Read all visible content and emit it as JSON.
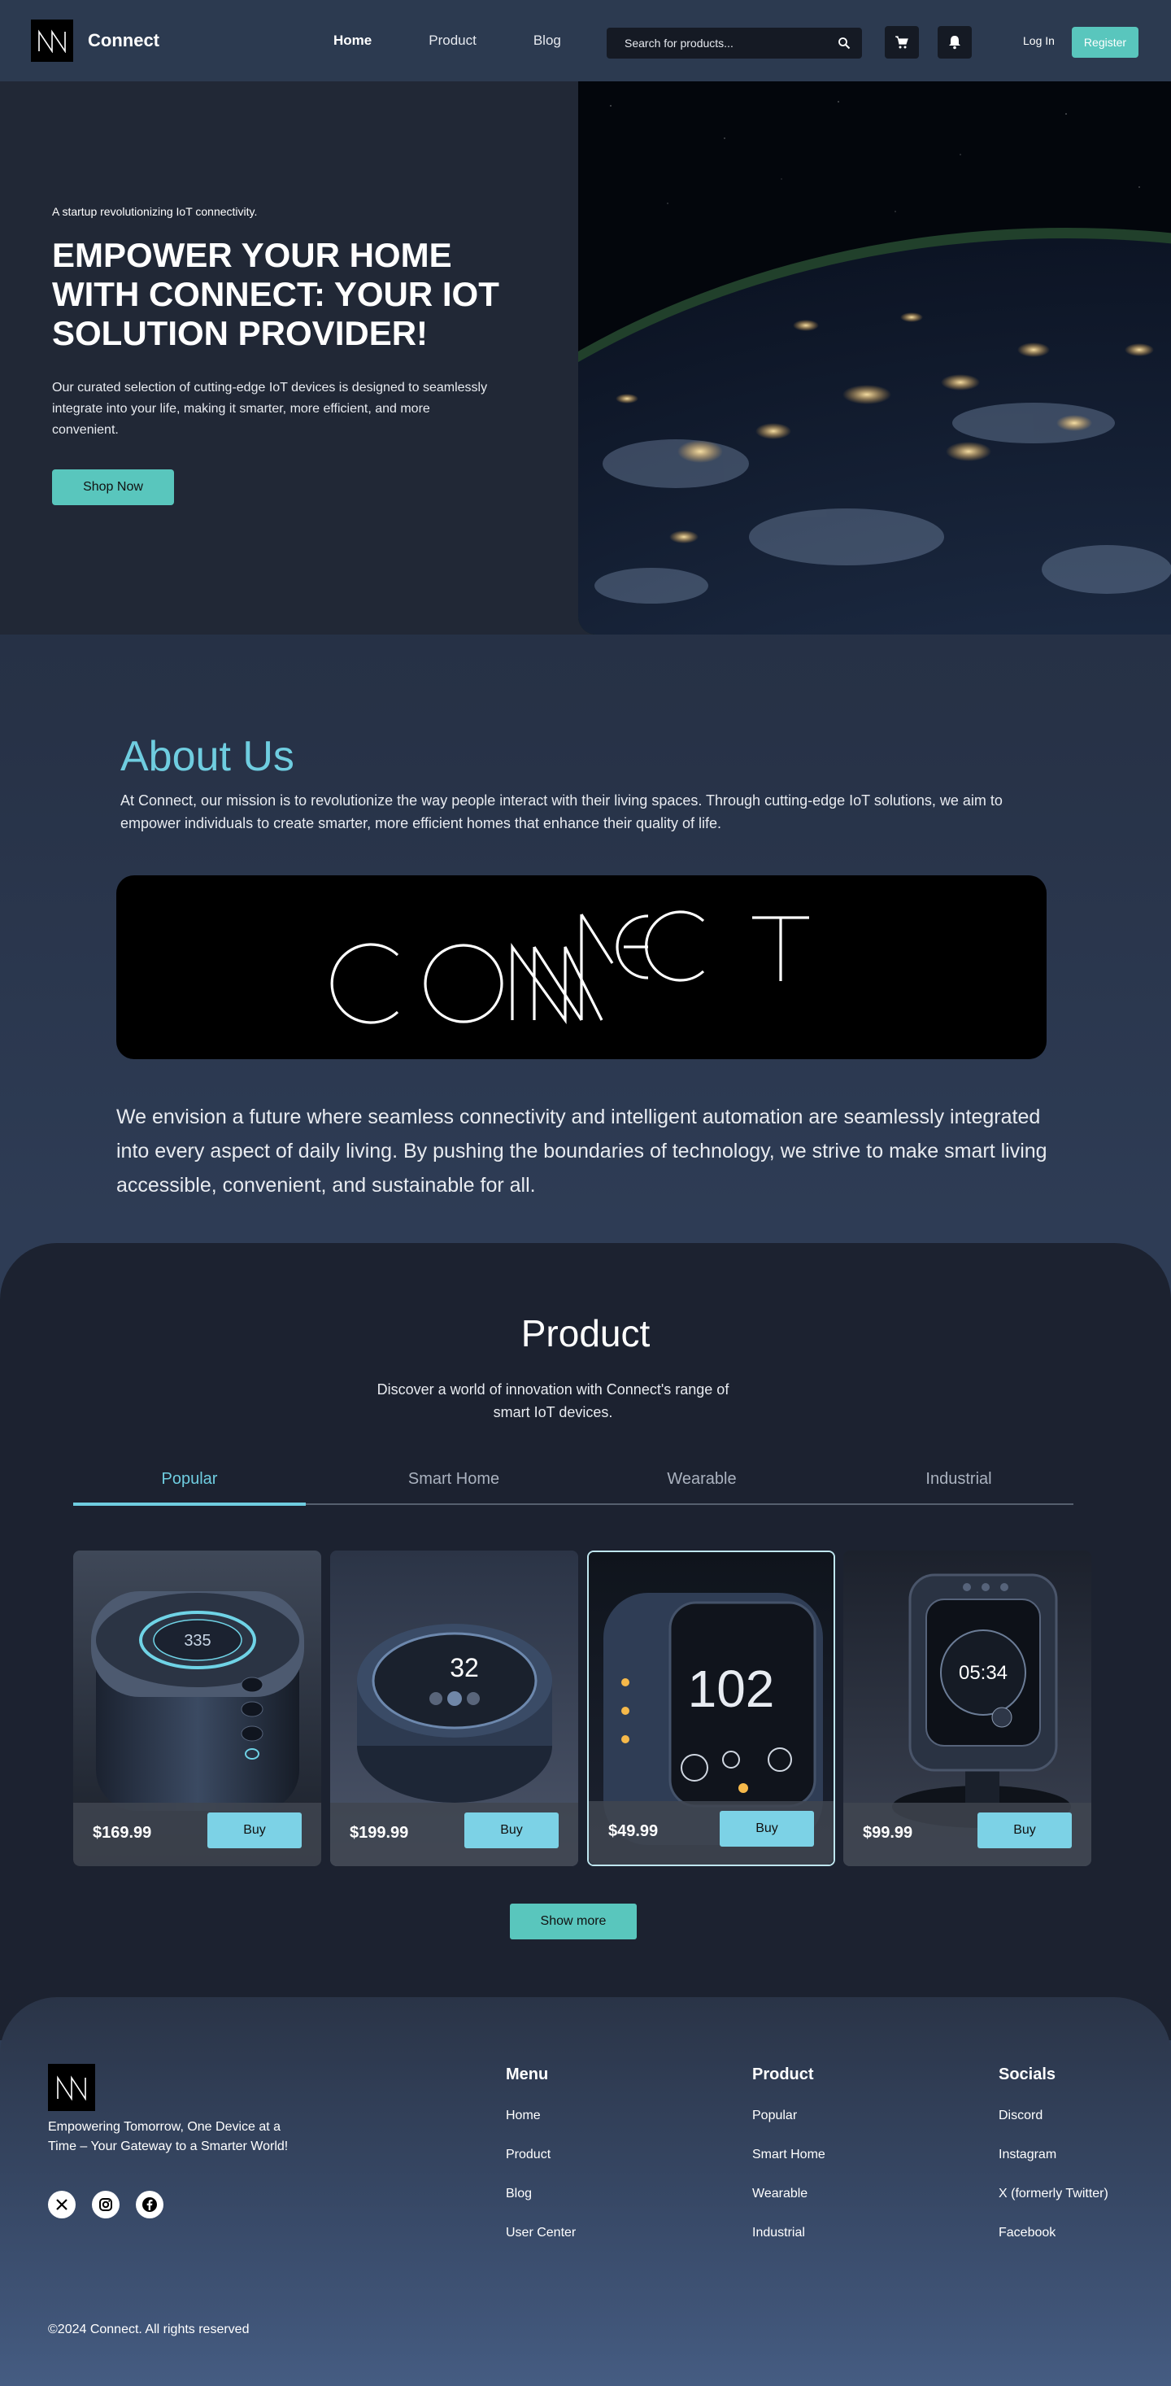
{
  "nav": {
    "brand": "Connect",
    "links": [
      "Home",
      "Product",
      "Blog"
    ],
    "search_placeholder": "Search for products...",
    "login": "Log In",
    "register": "Register"
  },
  "hero": {
    "tagline": "A startup revolutionizing IoT connectivity.",
    "title": "EMPOWER YOUR HOME WITH CONNECT: YOUR IOT SOLUTION PROVIDER!",
    "description": "Our curated selection of cutting-edge IoT devices is designed to seamlessly integrate into your life, making it smarter, more efficient, and more convenient.",
    "cta": "Shop Now"
  },
  "about": {
    "title": "About Us",
    "text": "At Connect, our mission is to revolutionize the way people interact with their living spaces. Through cutting-edge IoT solutions, we aim to empower individuals to create smarter, more efficient homes that enhance their quality of life.",
    "vision": "We envision a future where seamless connectivity and intelligent automation are seamlessly integrated into every aspect of daily living. By pushing the boundaries of technology, we strive to make smart living accessible, convenient, and sustainable for all."
  },
  "product": {
    "title": "Product",
    "subtitle": "Discover a world of innovation with Connect's range of smart IoT devices.",
    "tabs": [
      "Popular",
      "Smart Home",
      "Wearable",
      "Industrial"
    ],
    "active_tab": "Popular",
    "cards": [
      {
        "price": "$169.99",
        "buy": "Buy",
        "display": "335"
      },
      {
        "price": "$199.99",
        "buy": "Buy",
        "display": "32"
      },
      {
        "price": "$49.99",
        "buy": "Buy",
        "display": "102"
      },
      {
        "price": "$99.99",
        "buy": "Buy",
        "display": "05:34"
      }
    ],
    "show_more": "Show more"
  },
  "footer": {
    "tagline": "Empowering Tomorrow, One Device at a Time – Your Gateway to a Smarter World!",
    "columns": [
      {
        "title": "Menu",
        "links": [
          "Home",
          "Product",
          "Blog",
          "User Center"
        ]
      },
      {
        "title": "Product",
        "links": [
          "Popular",
          "Smart Home",
          "Wearable",
          "Industrial"
        ]
      },
      {
        "title": "Socials",
        "links": [
          "Discord",
          "Instagram",
          "X (formerly Twitter)",
          "Facebook"
        ]
      }
    ],
    "social_icons": [
      "x-icon",
      "instagram-icon",
      "facebook-icon"
    ],
    "copyright": "©2024 Connect. All rights reserved"
  },
  "colors": {
    "accent_teal": "#59c6bd",
    "accent_cyan": "#6fcde0",
    "nav_bg": "#2c3a50",
    "page_bg": "#222b3b"
  }
}
